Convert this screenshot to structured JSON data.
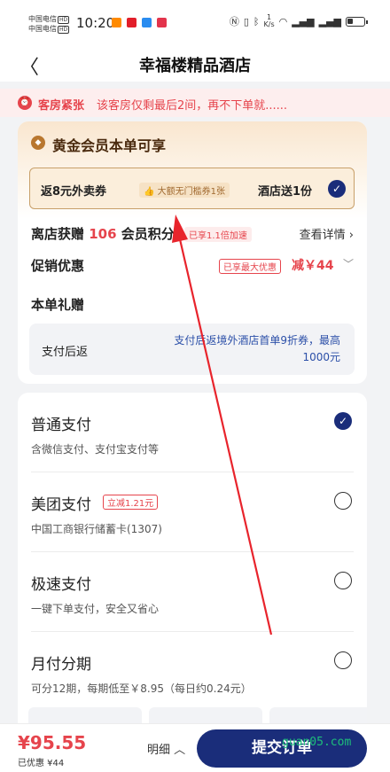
{
  "status_bar": {
    "carrier1": "中国电信",
    "carrier2": "中国电信",
    "hd": "HD",
    "time": "10:20",
    "net_speed_value": "1",
    "net_speed_unit": "K/s",
    "battery_level": 0.35,
    "app_colors": [
      "#ff8a00",
      "#e21e2a",
      "#2a8cf0",
      "#e3344c"
    ]
  },
  "nav": {
    "back_icon": "chevron-left-icon",
    "title": "幸福楼精品酒店"
  },
  "alert": {
    "icon": "alarm-icon",
    "label": "客房紧张",
    "text": "该客房仅剩最后2间，再不下单就......"
  },
  "member": {
    "icon": "diamond-icon",
    "title": "黄金会员本单可享",
    "coupon_label": "返8元外卖券",
    "coupon_badge": "大额无门槛券1张",
    "hotel_gift": "酒店送1份",
    "points_prefix": "离店获赠",
    "points_value": "106",
    "points_suffix": "会员积分",
    "points_badge": "已享1.1倍加速",
    "details_link": "查看详情 ›"
  },
  "promotion": {
    "label": "促销优惠",
    "badge": "已享最大优惠",
    "amount": "减￥44"
  },
  "gift": {
    "label": "本单礼赠",
    "box_label": "支付后返",
    "box_text": "支付后返境外酒店首单9折券，最高1000元"
  },
  "payments": [
    {
      "name": "普通支付",
      "desc": "含微信支付、支付宝支付等",
      "selected": true
    },
    {
      "name": "美团支付",
      "tag": "立减1.21元",
      "desc": "中国工商银行储蓄卡(1307)",
      "selected": false
    },
    {
      "name": "极速支付",
      "desc": "一键下单支付，安全又省心",
      "selected": false
    },
    {
      "name": "月付分期",
      "desc": "可分12期，每期低至￥8.95（每日约0.24元）",
      "selected": false
    }
  ],
  "bottom": {
    "total": "¥95.55",
    "saved": "已优惠 ¥44",
    "details": "明细 ︿",
    "submit": "提交订单"
  },
  "watermark": "guan05.com",
  "colors": {
    "accent_red": "#e6444c",
    "brand_navy": "#1a2d7a",
    "gold": "#b9772f",
    "annotation_red": "#e8242c"
  }
}
